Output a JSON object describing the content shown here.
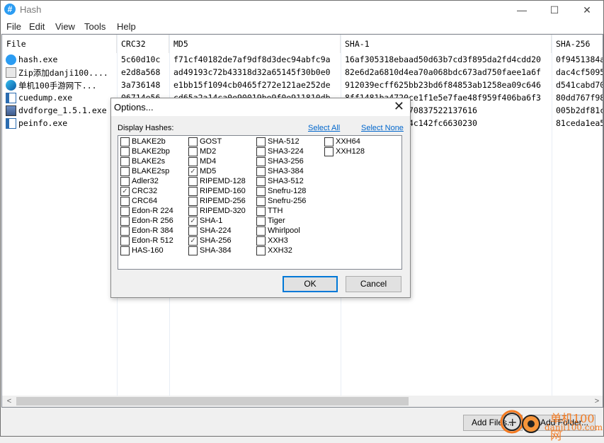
{
  "window": {
    "title": "Hash",
    "app_icon": "#",
    "controls": {
      "minimize": "—",
      "maximize": "☐",
      "close": "✕"
    }
  },
  "menu": [
    "File",
    "Edit",
    "View",
    "Tools",
    "Help"
  ],
  "table": {
    "columns": [
      "File",
      "CRC32",
      "MD5",
      "SHA-1",
      "SHA-256"
    ],
    "rows": [
      {
        "icon": "hash-app-icon",
        "file": "hash.exe",
        "crc32": "5c60d10c",
        "md5": "f71cf40182de7af9df8d3dec94abfc9a",
        "sha1": "16af305318ebaad50d63b7cd3f895da2fd4cdd20",
        "sha256": "0f9451384a"
      },
      {
        "icon": "zip-file-icon",
        "file": "Zip添加danji100....",
        "crc32": "e2d8a568",
        "md5": "ad49193c72b43318d32a65145f30b0e0",
        "sha1": "82e6d2a6810d4ea70a068bdc673ad750faee1a6f",
        "sha256": "dac4cf5095"
      },
      {
        "icon": "edge-browser-icon",
        "file": "单机100手游网下...",
        "crc32": "3a736148",
        "md5": "e1bb15f1094cb0465f272e121ae252de",
        "sha1": "912039ecff625bb23bd6f84853ab1258ea09c646",
        "sha256": "d541cabd70"
      },
      {
        "icon": "exe-window-icon",
        "file": "cuedump.exe",
        "crc32": "06714e56",
        "md5": "cd65a2a14ca0e90019be9f0e911810db",
        "sha1": "8ff1481ba4720ce1f1e5e7fae48f959f406ba6f3",
        "sha256": "80dd767f98"
      },
      {
        "icon": "installer-icon",
        "file": "dvdforge_1.5.1.exe",
        "crc32": "",
        "md5": "",
        "sha1": "bd8ba5d34bc7b70837522137616",
        "sha256": "005b2df81c"
      },
      {
        "icon": "exe-window-icon",
        "file": "peinfo.exe",
        "crc32": "",
        "md5": "",
        "sha1": "111d21587631d4c142fc6630230",
        "sha256": "81ceda1ea5"
      }
    ]
  },
  "buttons": {
    "add_files": "Add Files...",
    "add_folder": "Add Folder..."
  },
  "dialog": {
    "title": "Options...",
    "display_label": "Display Hashes:",
    "select_all": "Select All",
    "select_none": "Select None",
    "ok": "OK",
    "cancel": "Cancel",
    "columns": [
      [
        {
          "label": "BLAKE2b",
          "checked": false
        },
        {
          "label": "BLAKE2bp",
          "checked": false
        },
        {
          "label": "BLAKE2s",
          "checked": false
        },
        {
          "label": "BLAKE2sp",
          "checked": false
        },
        {
          "label": "Adler32",
          "checked": false
        },
        {
          "label": "CRC32",
          "checked": true
        },
        {
          "label": "CRC64",
          "checked": false
        },
        {
          "label": "Edon-R 224",
          "checked": false
        },
        {
          "label": "Edon-R 256",
          "checked": false
        },
        {
          "label": "Edon-R 384",
          "checked": false
        },
        {
          "label": "Edon-R 512",
          "checked": false
        },
        {
          "label": "HAS-160",
          "checked": false
        }
      ],
      [
        {
          "label": "GOST",
          "checked": false
        },
        {
          "label": "MD2",
          "checked": false
        },
        {
          "label": "MD4",
          "checked": false
        },
        {
          "label": "MD5",
          "checked": true
        },
        {
          "label": "RIPEMD-128",
          "checked": false
        },
        {
          "label": "RIPEMD-160",
          "checked": false
        },
        {
          "label": "RIPEMD-256",
          "checked": false
        },
        {
          "label": "RIPEMD-320",
          "checked": false
        },
        {
          "label": "SHA-1",
          "checked": true
        },
        {
          "label": "SHA-224",
          "checked": false
        },
        {
          "label": "SHA-256",
          "checked": true
        },
        {
          "label": "SHA-384",
          "checked": false
        }
      ],
      [
        {
          "label": "SHA-512",
          "checked": false
        },
        {
          "label": "SHA3-224",
          "checked": false
        },
        {
          "label": "SHA3-256",
          "checked": false
        },
        {
          "label": "SHA3-384",
          "checked": false
        },
        {
          "label": "SHA3-512",
          "checked": false
        },
        {
          "label": "Snefru-128",
          "checked": false
        },
        {
          "label": "Snefru-256",
          "checked": false
        },
        {
          "label": "TTH",
          "checked": false
        },
        {
          "label": "Tiger",
          "checked": false
        },
        {
          "label": "Whirlpool",
          "checked": false
        },
        {
          "label": "XXH3",
          "checked": false
        },
        {
          "label": "XXH32",
          "checked": false
        }
      ],
      [
        {
          "label": "XXH64",
          "checked": false
        },
        {
          "label": "XXH128",
          "checked": false
        }
      ]
    ]
  },
  "watermark": {
    "line1": "单机100网",
    "line2": "danji100.com"
  }
}
